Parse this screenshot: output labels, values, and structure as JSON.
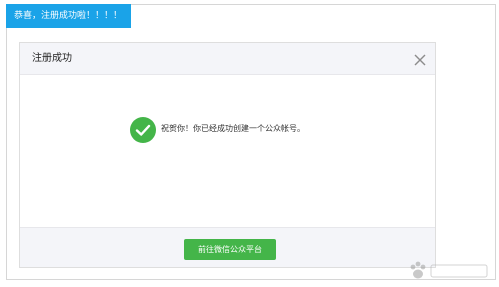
{
  "banner": {
    "text": "恭喜，注册成功啦！！！！"
  },
  "dialog": {
    "title": "注册成功",
    "message": "祝贺你！你已经成功创建一个公众帐号。",
    "primary_button_label": "前往微信公众平台"
  },
  "icons": {
    "close": "close-icon",
    "success": "checkmark-circle-icon"
  },
  "colors": {
    "banner": "#1aa3e8",
    "success": "#44b549",
    "button": "#44b549",
    "header_bg": "#f4f5f9"
  }
}
